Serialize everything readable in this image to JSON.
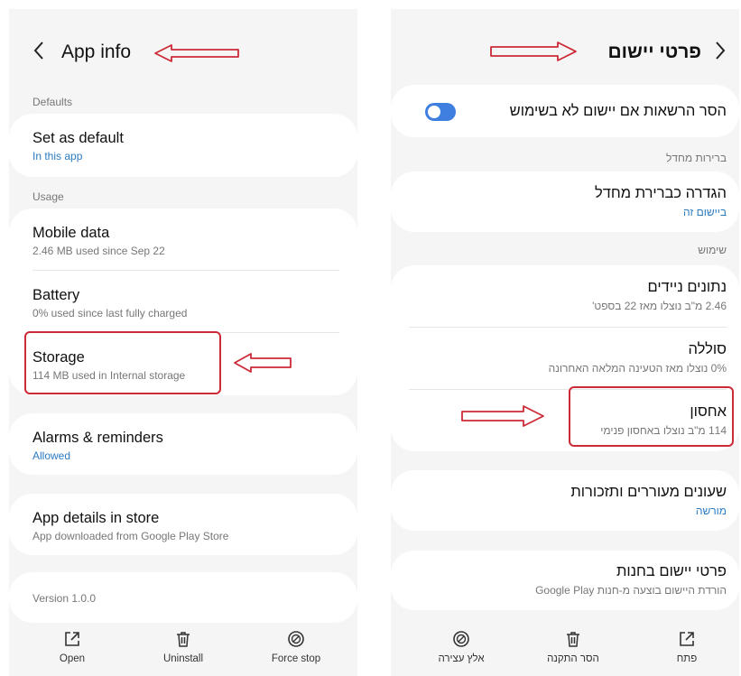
{
  "left": {
    "header": {
      "title": "App info"
    },
    "sections": {
      "defaults": "Defaults",
      "usage": "Usage"
    },
    "items": {
      "set_default": {
        "title": "Set as default",
        "sub": "In this app"
      },
      "mobile_data": {
        "title": "Mobile data",
        "sub": "2.46 MB used since Sep 22"
      },
      "battery": {
        "title": "Battery",
        "sub": "0% used since last fully charged"
      },
      "storage": {
        "title": "Storage",
        "sub": "114 MB used in Internal storage"
      },
      "alarms": {
        "title": "Alarms & reminders",
        "sub": "Allowed"
      },
      "store": {
        "title": "App details in store",
        "sub": "App downloaded from Google Play Store"
      },
      "version": "Version 1.0.0"
    },
    "actions": {
      "open": "Open",
      "uninstall": "Uninstall",
      "force_stop": "Force stop"
    }
  },
  "right": {
    "header": {
      "title": "פרטי יישום"
    },
    "items": {
      "permissions": {
        "title": "הסר הרשאות אם יישום לא בשימוש",
        "toggle_on": true
      },
      "set_default": {
        "title": "הגדרה כברירת מחדל",
        "sub": "ביישום זה"
      },
      "mobile_data": {
        "title": "נתונים ניידים",
        "sub": "2.46 מ\"ב נוצלו מאז 22 בספט'"
      },
      "battery": {
        "title": "סוללה",
        "sub": "0% נוצלו מאז הטעינה המלאה האחרונה"
      },
      "storage": {
        "title": "אחסון",
        "sub": "114 מ\"ב נוצלו באחסון פנימי"
      },
      "alarms": {
        "title": "שעונים מעוררים ותזכורות",
        "sub": "מורשה"
      },
      "store": {
        "title": "פרטי יישום בחנות",
        "sub": "הורדת היישום בוצעה מ-חנות Google Play"
      }
    },
    "sections": {
      "defaults": "ברירות מחדל",
      "usage": "שימוש"
    },
    "actions": {
      "open": "פתח",
      "uninstall": "הסר התקנה",
      "force_stop": "אלץ עצירה"
    }
  },
  "colors": {
    "highlight": "#cc2a36",
    "link": "#2b7bc2",
    "toggle": "#3f7fe0",
    "background": "#f5f5f5"
  }
}
